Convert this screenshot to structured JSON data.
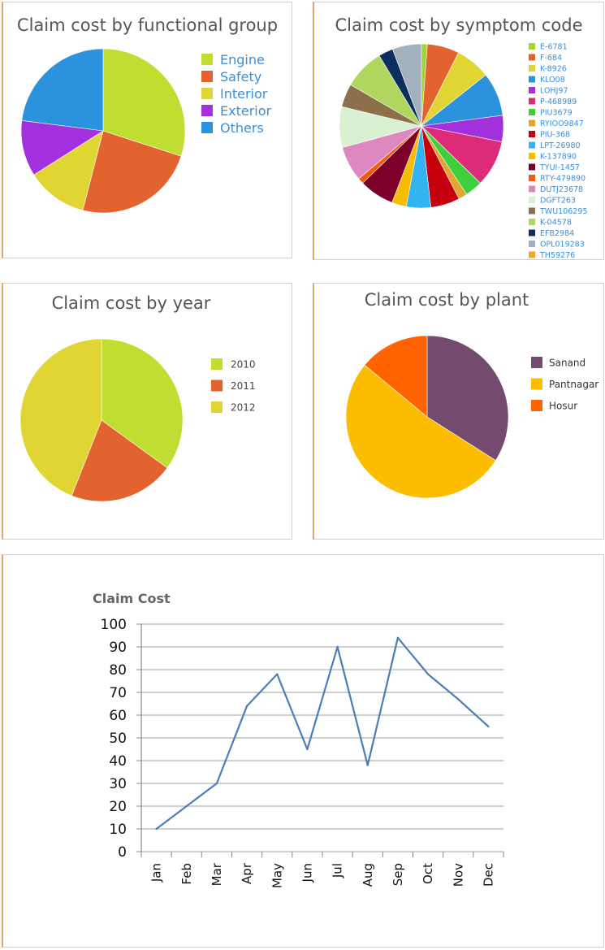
{
  "chart_data": [
    {
      "type": "pie",
      "title": "Claim cost by functional group",
      "legend_position": "right",
      "categories": [
        "Engine",
        "Safety",
        "Interior",
        "Exterior",
        "Others"
      ],
      "values": [
        30,
        24,
        12,
        11,
        23
      ],
      "colors": [
        "#c0dd31",
        "#e3632f",
        "#e0d533",
        "#a330dd",
        "#2b92dd"
      ],
      "start_deg": 0,
      "legend_order": [
        0,
        1,
        2,
        3,
        4
      ]
    },
    {
      "type": "pie",
      "title": "Claim cost by symptom code",
      "legend_position": "right",
      "categories": [
        "E-6781",
        "F-684",
        "K-8926",
        "KLO08",
        "LOHJ97",
        "P-468989",
        "PIU3679",
        "RYIOO9847",
        "PIU-368",
        "LPT-26980",
        "K-137890",
        "TYUI-1457",
        "RTY-479890",
        "DUTJ23678",
        "DGFT263",
        "TWU106295",
        "K-04578",
        "EFB2984",
        "OPL019283",
        "TH59276"
      ],
      "values": [
        1,
        5.5,
        6,
        7.5,
        4.5,
        8,
        3,
        1.5,
        5,
        4.2,
        2.5,
        6,
        1,
        6,
        7,
        4,
        7,
        2.5,
        5,
        0
      ],
      "colors": [
        "#9ed433",
        "#e3632f",
        "#e0d533",
        "#2b92dd",
        "#a330dd",
        "#dd2b7a",
        "#3ecf3c",
        "#e0a62f",
        "#c6000d",
        "#33b4f0",
        "#f6bd00",
        "#7d0028",
        "#f05a12",
        "#dd88bf",
        "#d9f0d2",
        "#8c704c",
        "#b0d660",
        "#0d2f5e",
        "#a3b1bc",
        "#f5a623"
      ],
      "start_deg": 0,
      "legend_order": [
        0,
        1,
        2,
        3,
        4,
        5,
        6,
        7,
        8,
        9,
        10,
        11,
        12,
        13,
        14,
        15,
        16,
        17,
        18,
        19
      ]
    },
    {
      "type": "pie",
      "title": "Claim cost by year",
      "legend_position": "right",
      "categories": [
        "2010",
        "2011",
        "2012"
      ],
      "values": [
        35,
        21,
        44
      ],
      "colors": [
        "#c0dd31",
        "#e3632f",
        "#e0d533"
      ],
      "start_deg": 0,
      "legend_order": [
        0,
        1,
        2
      ]
    },
    {
      "type": "pie",
      "title": "Claim cost by plant",
      "legend_position": "right",
      "categories": [
        "Sanand",
        "Pantnagar",
        "Hosur"
      ],
      "values": [
        34,
        52,
        14
      ],
      "colors": [
        "#744b6e",
        "#fcbd00",
        "#ff6400"
      ],
      "start_deg": 0,
      "legend_order": [
        0,
        1,
        2
      ]
    },
    {
      "type": "line",
      "title": "Claim Cost",
      "categories": [
        "Jan",
        "Feb",
        "Mar",
        "Apr",
        "May",
        "Jun",
        "Jul",
        "Aug",
        "Sep",
        "Oct",
        "Nov",
        "Dec"
      ],
      "series": [
        {
          "values": [
            10,
            20,
            30,
            64,
            78,
            45,
            90,
            38,
            94,
            78,
            67,
            55
          ],
          "color": "#4a7eba"
        }
      ],
      "ylim": [
        0,
        100
      ],
      "yticks": [
        0,
        10,
        20,
        30,
        40,
        50,
        60,
        70,
        80,
        90,
        100
      ],
      "grid": true,
      "legend": false
    }
  ]
}
